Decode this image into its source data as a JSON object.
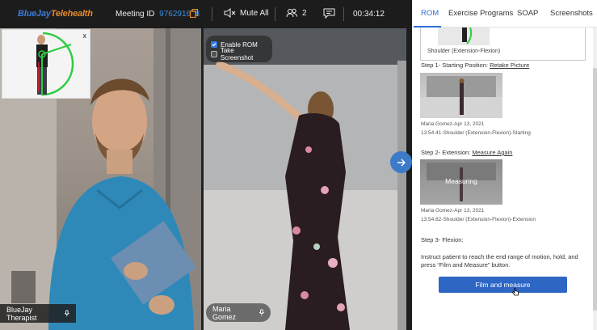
{
  "topbar": {
    "brand_part1": "BlueJay",
    "brand_part2": "Telehealth",
    "meeting_label": "Meeting ID",
    "meeting_id": "976291678",
    "mute_label": "Mute All",
    "participants": "2",
    "timer": "00:34:12",
    "icons": [
      "copy-icon",
      "speaker-muted-icon",
      "people-icon",
      "chat-icon"
    ]
  },
  "overlay": {
    "close": "x",
    "enable_rom": "Enable ROM",
    "take_screenshot": "Take Screenshot",
    "therapist_name": "BlueJay Therapist",
    "patient_name": "Maria Gomez"
  },
  "tabs": [
    "ROM",
    "Exercise Programs",
    "SOAP",
    "Screenshots"
  ],
  "rom": {
    "top_caption": "Shoulder (Extension-Flexion)",
    "step1_label": "Step 1- Starting Position:",
    "step1_link": "Retake Picture",
    "step1_meta1": "Maria Gomez-Apr 13, 2021",
    "step1_meta2": "13:54:41-Shoulder (Extension-Flexion)-Starting",
    "step2_label": "Step 2- Extension:",
    "step2_link": "Measure Again",
    "step2_status": "Measuring",
    "step2_meta1": "Maria Gomez-Apr 13, 2021",
    "step2_meta2": "13:54:82-Shoulder (Extension-Flexion)-Extension",
    "step3_label": "Step 3- Flexion:",
    "instruction_line1": "Instruct patient to reach the end range of motion, hold, and",
    "instruction_line2": "press “Film and Measure” button.",
    "button_label": "Film and measure"
  },
  "colors": {
    "accent": "#2d66c4",
    "brand_blue": "#3d7bd9",
    "brand_orange": "#e98a2b",
    "topbar_bg": "#1c1c1c"
  }
}
